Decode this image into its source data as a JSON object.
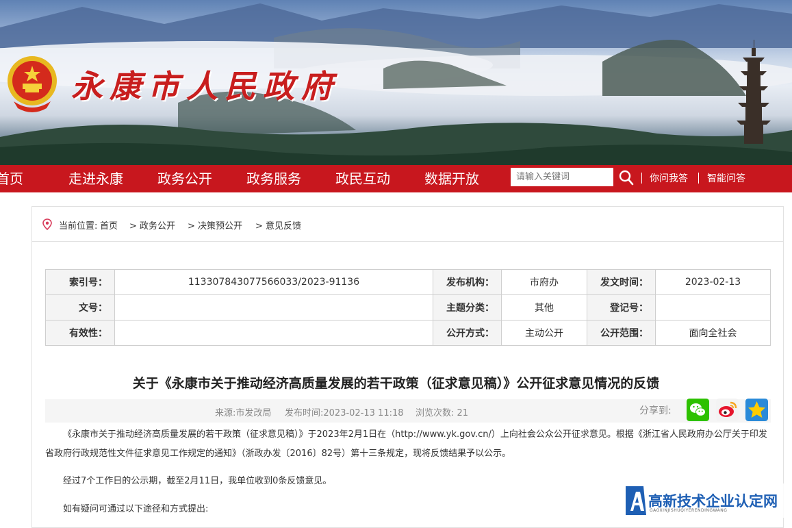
{
  "header": {
    "site_title": "永康市人民政府"
  },
  "nav": {
    "items": [
      "首页",
      "走进永康",
      "政务公开",
      "政务服务",
      "政民互动",
      "数据开放"
    ],
    "search_placeholder": "请输入关键词",
    "links": [
      "你问我答",
      "智能问答"
    ]
  },
  "breadcrumb": {
    "prefix": "当前位置:",
    "items": [
      "首页",
      "> 政务公开",
      "> 决策预公开",
      "> 意见反馈"
    ]
  },
  "info_table": {
    "rows": [
      [
        {
          "label": "索引号：",
          "value": "113307843077566033/2023-91136"
        },
        {
          "label": "发布机构：",
          "value": "市府办"
        },
        {
          "label": "发文时间：",
          "value": "2023-02-13"
        }
      ],
      [
        {
          "label": "文号：",
          "value": ""
        },
        {
          "label": "主题分类：",
          "value": "其他"
        },
        {
          "label": "登记号：",
          "value": ""
        }
      ],
      [
        {
          "label": "有效性：",
          "value": ""
        },
        {
          "label": "公开方式：",
          "value": "主动公开"
        },
        {
          "label": "公开范围：",
          "value": "面向全社会"
        }
      ]
    ]
  },
  "article": {
    "title": "关于《永康市关于推动经济高质量发展的若干政策（征求意见稿）》公开征求意见情况的反馈",
    "source": "来源:市发改局",
    "publish_time": "发布时间:2023-02-13 11:18",
    "views": "浏览次数: 21",
    "share_label": "分享到:",
    "paragraphs": [
      "《永康市关于推动经济高质量发展的若干政策（征求意见稿）》于2023年2月1日在（http://www.yk.gov.cn/）上向社会公众公开征求意见。根据《浙江省人民政府办公厅关于印发省政府行政规范性文件征求意见工作规定的通知》（浙政办发〔2016〕82号）第十三条规定，现将反馈结果予以公示。",
      "经过7个工作日的公示期，截至2月11日，我单位收到0条反馈意见。",
      "如有疑问可通过以下途径和方式提出:"
    ]
  },
  "watermark": {
    "text": "高新技术企业认定网",
    "sub": "GAOXINJISHUQIYERENDINGWANG"
  },
  "colors": {
    "nav_red": "#c8171e",
    "wechat_green": "#2dc100",
    "weibo": "#f6a623",
    "qzone_blue": "#2a8ad8",
    "watermark_blue": "#1e5fb4"
  }
}
